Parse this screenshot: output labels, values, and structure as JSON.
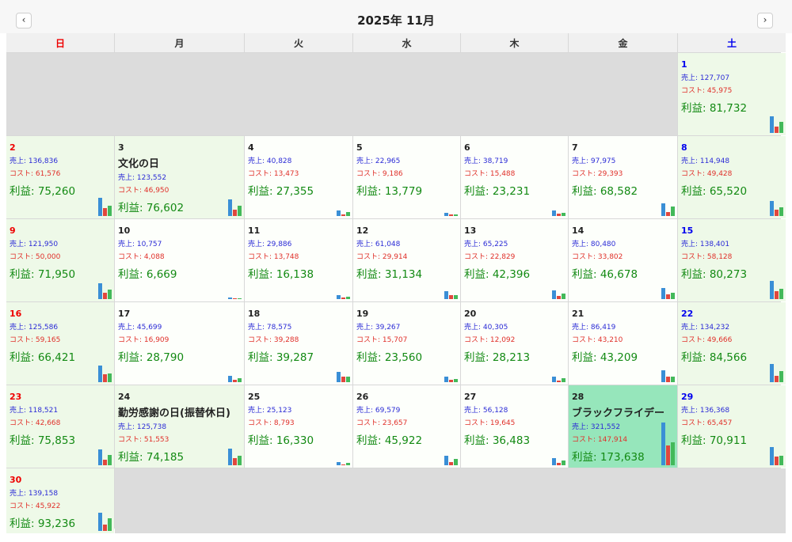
{
  "header": {
    "title": "2025年 11月",
    "prev_label": "‹",
    "next_label": "›"
  },
  "weekdays": [
    {
      "label": "日",
      "kind": "sun"
    },
    {
      "label": "月",
      "kind": "wd"
    },
    {
      "label": "火",
      "kind": "wd"
    },
    {
      "label": "水",
      "kind": "wd"
    },
    {
      "label": "木",
      "kind": "wd"
    },
    {
      "label": "金",
      "kind": "wd"
    },
    {
      "label": "土",
      "kind": "sat"
    }
  ],
  "labels": {
    "sales_prefix": "売上: ",
    "cost_prefix": "コスト: ",
    "profit_prefix": "利益: "
  },
  "colors": {
    "sales": "#3a8fd6",
    "cost": "#e0473e",
    "profit": "#43b95a",
    "sunday": "#e00000",
    "saturday": "#0000ee",
    "highlight": "#96e6bb"
  },
  "leading_empty_cells": 6,
  "trailing_empty_cells": 6,
  "days": [
    {
      "day": "1",
      "holiday": "",
      "sales": "127,707",
      "cost": "45,975",
      "profit": "81,732"
    },
    {
      "day": "2",
      "holiday": "",
      "sales": "136,836",
      "cost": "61,576",
      "profit": "75,260"
    },
    {
      "day": "3",
      "holiday": "文化の日",
      "sales": "123,552",
      "cost": "46,950",
      "profit": "76,602"
    },
    {
      "day": "4",
      "holiday": "",
      "sales": "40,828",
      "cost": "13,473",
      "profit": "27,355"
    },
    {
      "day": "5",
      "holiday": "",
      "sales": "22,965",
      "cost": "9,186",
      "profit": "13,779"
    },
    {
      "day": "6",
      "holiday": "",
      "sales": "38,719",
      "cost": "15,488",
      "profit": "23,231"
    },
    {
      "day": "7",
      "holiday": "",
      "sales": "97,975",
      "cost": "29,393",
      "profit": "68,582"
    },
    {
      "day": "8",
      "holiday": "",
      "sales": "114,948",
      "cost": "49,428",
      "profit": "65,520"
    },
    {
      "day": "9",
      "holiday": "",
      "sales": "121,950",
      "cost": "50,000",
      "profit": "71,950"
    },
    {
      "day": "10",
      "holiday": "",
      "sales": "10,757",
      "cost": "4,088",
      "profit": "6,669"
    },
    {
      "day": "11",
      "holiday": "",
      "sales": "29,886",
      "cost": "13,748",
      "profit": "16,138"
    },
    {
      "day": "12",
      "holiday": "",
      "sales": "61,048",
      "cost": "29,914",
      "profit": "31,134"
    },
    {
      "day": "13",
      "holiday": "",
      "sales": "65,225",
      "cost": "22,829",
      "profit": "42,396"
    },
    {
      "day": "14",
      "holiday": "",
      "sales": "80,480",
      "cost": "33,802",
      "profit": "46,678"
    },
    {
      "day": "15",
      "holiday": "",
      "sales": "138,401",
      "cost": "58,128",
      "profit": "80,273"
    },
    {
      "day": "16",
      "holiday": "",
      "sales": "125,586",
      "cost": "59,165",
      "profit": "66,421"
    },
    {
      "day": "17",
      "holiday": "",
      "sales": "45,699",
      "cost": "16,909",
      "profit": "28,790"
    },
    {
      "day": "18",
      "holiday": "",
      "sales": "78,575",
      "cost": "39,288",
      "profit": "39,287"
    },
    {
      "day": "19",
      "holiday": "",
      "sales": "39,267",
      "cost": "15,707",
      "profit": "23,560"
    },
    {
      "day": "20",
      "holiday": "",
      "sales": "40,305",
      "cost": "12,092",
      "profit": "28,213"
    },
    {
      "day": "21",
      "holiday": "",
      "sales": "86,419",
      "cost": "43,210",
      "profit": "43,209"
    },
    {
      "day": "22",
      "holiday": "",
      "sales": "134,232",
      "cost": "49,666",
      "profit": "84,566"
    },
    {
      "day": "23",
      "holiday": "",
      "sales": "118,521",
      "cost": "42,668",
      "profit": "75,853"
    },
    {
      "day": "24",
      "holiday": "勤労感謝の日(振替休日)",
      "sales": "125,738",
      "cost": "51,553",
      "profit": "74,185"
    },
    {
      "day": "25",
      "holiday": "",
      "sales": "25,123",
      "cost": "8,793",
      "profit": "16,330"
    },
    {
      "day": "26",
      "holiday": "",
      "sales": "69,579",
      "cost": "23,657",
      "profit": "45,922"
    },
    {
      "day": "27",
      "holiday": "",
      "sales": "56,128",
      "cost": "19,645",
      "profit": "36,483"
    },
    {
      "day": "28",
      "holiday": "ブラックフライデー",
      "sales": "321,552",
      "cost": "147,914",
      "profit": "173,638",
      "highlight": true
    },
    {
      "day": "29",
      "holiday": "",
      "sales": "136,368",
      "cost": "65,457",
      "profit": "70,911"
    },
    {
      "day": "30",
      "holiday": "",
      "sales": "139,158",
      "cost": "45,922",
      "profit": "93,236"
    }
  ]
}
